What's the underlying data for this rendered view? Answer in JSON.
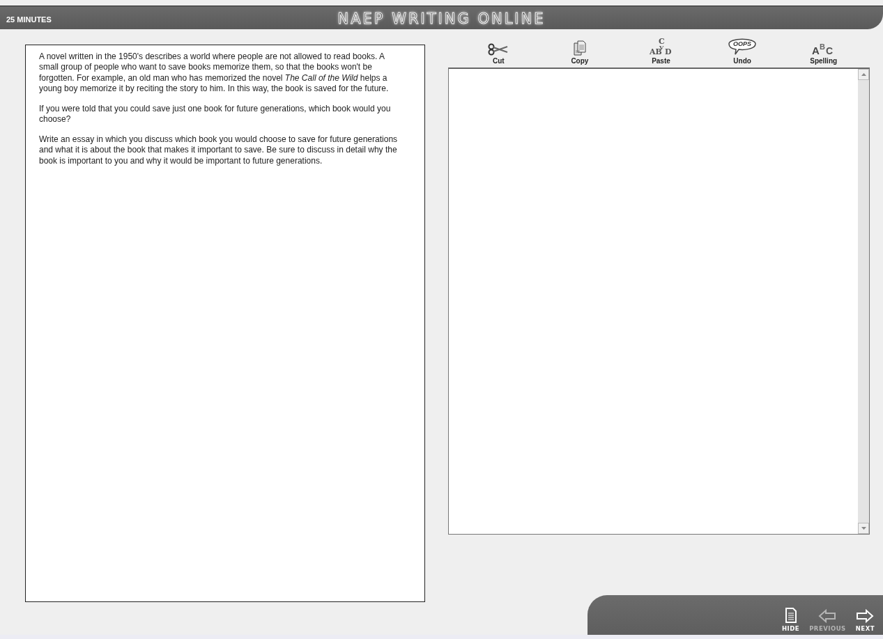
{
  "header": {
    "timer": "25 MINUTES",
    "title": "NAEP WRITING ONLINE"
  },
  "prompt": {
    "paragraphs": [
      "A novel written in the 1950's describes a world where people are not allowed to read books. A small group of people who want to save books memorize them, so that the books won't be forgotten. For example, an old man who has memorized the novel *The Call of the Wild* helps a young boy memorize it by reciting the story to him. In this way, the book is saved for the future.",
      "If you were told that you could save just one book for future generations, which book would you choose?",
      "Write an essay in which you discuss which book you would choose to save for future generations and what it is about the book that makes it important to save. Be sure to discuss in detail why the book is important to you and why it would be important to future generations."
    ]
  },
  "toolbar": [
    {
      "kind": "cut",
      "label": "Cut"
    },
    {
      "kind": "copy",
      "label": "Copy"
    },
    {
      "kind": "paste",
      "label": "Paste",
      "glyph": [
        "C",
        "AB",
        "V",
        "D"
      ]
    },
    {
      "kind": "undo",
      "label": "Undo",
      "glyph": [
        "OOPS"
      ]
    },
    {
      "kind": "spelling",
      "label": "Spelling",
      "glyph": [
        "A",
        "B",
        "C"
      ]
    }
  ],
  "nav": [
    {
      "kind": "hide",
      "label": "HIDE",
      "disabled": false
    },
    {
      "kind": "previous",
      "label": "PREVIOUS",
      "disabled": true
    },
    {
      "kind": "next",
      "label": "NEXT",
      "disabled": false
    }
  ]
}
